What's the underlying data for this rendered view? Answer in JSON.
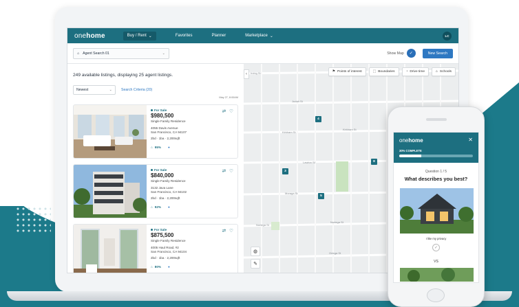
{
  "header": {
    "logo_pre": "one",
    "logo_bold": "home",
    "nav": [
      "Buy / Rent",
      "Favorites",
      "Planner",
      "Marketplace"
    ],
    "avatar_initials": "LC"
  },
  "toolbar": {
    "agent_search": "Agent Search 01",
    "show_map_label": "Show Map",
    "new_search_label": "New Search"
  },
  "listings_summary": "249 available listings, displaying 25 agent listings.",
  "sort": {
    "value": "Newest",
    "criteria_link": "Search Criteria (20)"
  },
  "date_stamp": "May 27, 8:00AM",
  "listings": [
    {
      "status": "For Sale",
      "price": "$980,500",
      "type": "Single Family Residence",
      "address1": "4055 Davis Avenue",
      "address2": "San Francisco, CA 94107",
      "specs": "2bd · 1ba · 2,200sqft",
      "match": "95%"
    },
    {
      "status": "For Sale",
      "price": "$840,000",
      "type": "Single Family Residence",
      "address1": "3132 Java Lane",
      "address2": "San Francisco, CA 94102",
      "specs": "2bd · 1ba · 2,200sqft",
      "match": "92%"
    },
    {
      "status": "For Sale",
      "price": "$875,500",
      "type": "Single Family Residence",
      "address1": "4005 Haul Road, #2",
      "address2": "San Francisco, CA 94104",
      "specs": "2bd · 1ba · 2,200sqft",
      "match": "80%"
    }
  ],
  "map": {
    "buttons": [
      "Points of interest",
      "Boundaries",
      "Drive time",
      "Schools"
    ],
    "streets": [
      "Irving St",
      "Judah St",
      "Kirkham St",
      "Kirkham St",
      "Lawton St",
      "Moraga St",
      "Noriega St",
      "Noriega St",
      "Ortega St",
      "Lincoln Way"
    ],
    "markers": [
      "4",
      "3",
      "8",
      "5"
    ]
  },
  "phone": {
    "logo_pre": "one",
    "logo_bold": "home",
    "progress_label": "30% COMPLETE",
    "progress": 0.3,
    "question_counter": "Question 1 / 5",
    "question": "What describes you best?",
    "option_caption": "I like my privacy",
    "vs_label": "VS"
  },
  "colors": {
    "brand": "#1d6f80",
    "accent": "#2e78c2",
    "background_band": "#1c7a8a"
  }
}
